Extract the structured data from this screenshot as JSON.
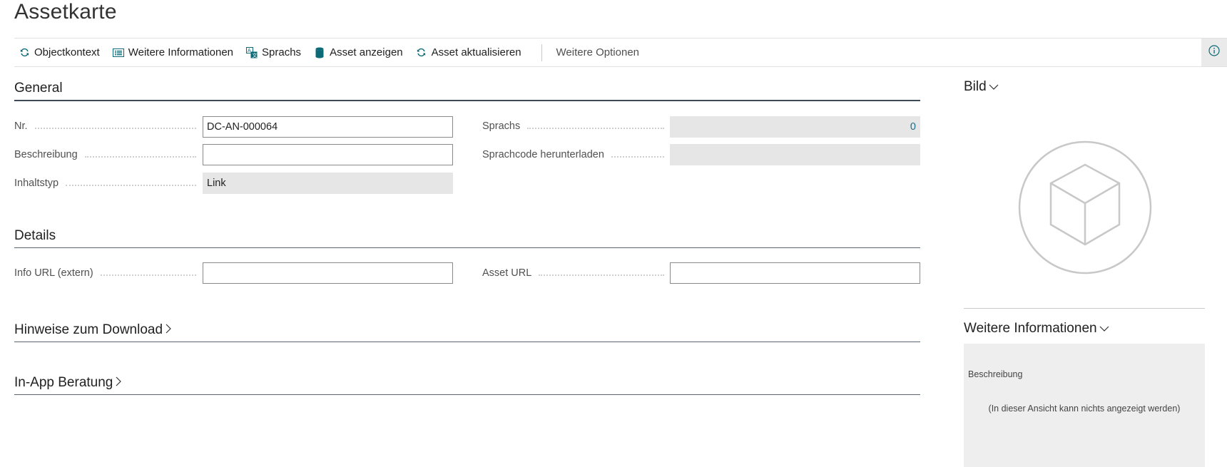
{
  "page": {
    "title": "Assetkarte"
  },
  "actions": [
    {
      "label": "Objectkontext",
      "icon": "refresh-icon"
    },
    {
      "label": "Weitere Informationen",
      "icon": "list-icon"
    },
    {
      "label": "Sprachs",
      "icon": "language-icon"
    },
    {
      "label": "Asset anzeigen",
      "icon": "database-icon"
    },
    {
      "label": "Asset aktualisieren",
      "icon": "refresh-icon"
    }
  ],
  "more_options": "Weitere Optionen",
  "sections": {
    "general": "General",
    "details": "Details",
    "download": "Hinweise zum Download",
    "inapp": "In-App Beratung"
  },
  "fields": {
    "nr": {
      "label": "Nr.",
      "value": "DC-AN-000064"
    },
    "beschreibung": {
      "label": "Beschreibung",
      "value": ""
    },
    "inhaltstyp": {
      "label": "Inhaltstyp",
      "value": "Link"
    },
    "sprachs": {
      "label": "Sprachs",
      "value": "0"
    },
    "sprachcode": {
      "label": "Sprachcode herunterladen",
      "value": ""
    },
    "info_url": {
      "label": "Info URL (extern)",
      "value": ""
    },
    "asset_url": {
      "label": "Asset URL",
      "value": ""
    }
  },
  "factbox": {
    "bild_title": "Bild",
    "info_title": "Weitere Informationen",
    "info_label": "Beschreibung",
    "info_empty": "(In dieser Ansicht kann nichts angezeigt werden)"
  },
  "colors": {
    "accent": "#1a6e8a",
    "icon_teal": "#0b6a75"
  }
}
